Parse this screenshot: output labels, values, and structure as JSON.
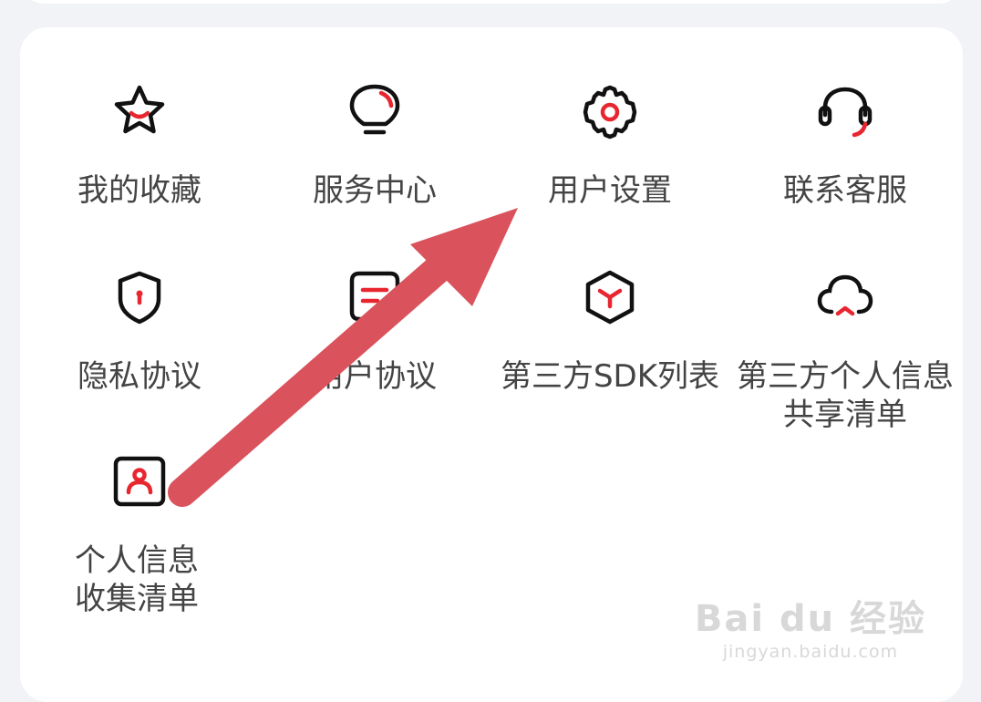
{
  "menu": {
    "items": [
      {
        "label": "我的收藏",
        "icon": "star-icon"
      },
      {
        "label": "服务中心",
        "icon": "lightbulb-icon"
      },
      {
        "label": "用户设置",
        "icon": "gear-icon"
      },
      {
        "label": "联系客服",
        "icon": "headset-icon"
      },
      {
        "label": "隐私协议",
        "icon": "shield-icon"
      },
      {
        "label": "用户协议",
        "icon": "document-icon"
      },
      {
        "label": "第三方SDK列表",
        "icon": "cube-icon"
      },
      {
        "label": "第三方个人信息\n共享清单",
        "icon": "cloud-icon"
      },
      {
        "label": "个人信息\n收集清单",
        "icon": "user-card-icon"
      }
    ]
  },
  "watermark": {
    "logo": "Bai du 经验",
    "url": "jingyan.baidu.com"
  },
  "colors": {
    "accent": "#e8262f",
    "arrow": "#d9525c",
    "text": "#444444",
    "icon_stroke": "#111111",
    "background": "#f2f3f6",
    "card": "#ffffff"
  }
}
